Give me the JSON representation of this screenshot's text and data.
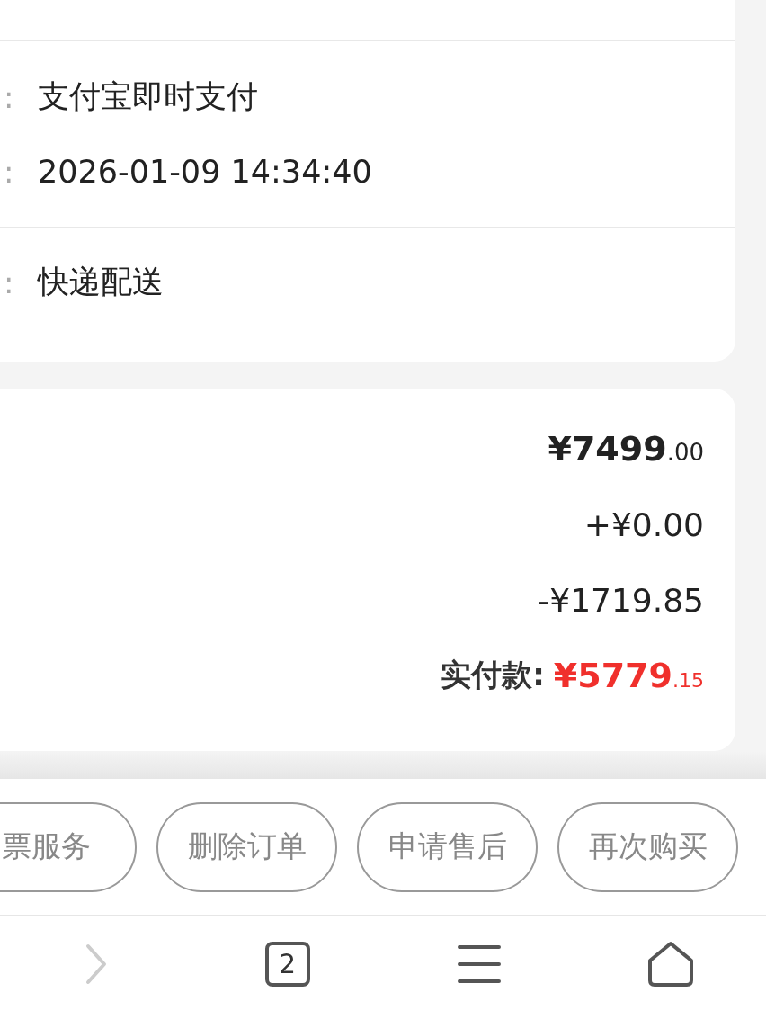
{
  "order_info": {
    "groups": [
      {
        "rows": [
          {
            "colon": ":",
            "value": "支付宝即时支付"
          },
          {
            "colon": ":",
            "value": "2026-01-09 14:34:40"
          }
        ]
      },
      {
        "rows": [
          {
            "colon": ":",
            "value": "快递配送"
          }
        ]
      }
    ]
  },
  "price_summary": {
    "rows": [
      {
        "kind": "major",
        "integer": "¥7499",
        "decimal": ".00"
      },
      {
        "kind": "plain",
        "value": "+¥0.00"
      },
      {
        "kind": "plain",
        "value": "-¥1719.85"
      },
      {
        "kind": "total",
        "label": "实付款:",
        "integer": "¥5779",
        "decimal": ".15",
        "color": "#f0302c"
      }
    ]
  },
  "actions": [
    "票服务",
    "删除订单",
    "申请售后",
    "再次购买"
  ],
  "nav_bar": [
    {
      "kind": "forward",
      "disabled": true
    },
    {
      "kind": "tabs",
      "count": "2"
    },
    {
      "kind": "menu"
    },
    {
      "kind": "home"
    }
  ]
}
